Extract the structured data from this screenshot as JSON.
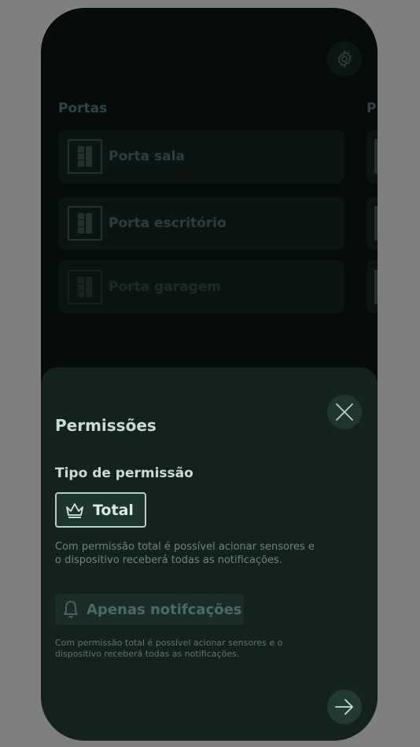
{
  "background": {
    "settings_icon": "gear-icon",
    "sections": [
      {
        "title": "Portas",
        "doors": [
          {
            "label": "Porta sala"
          },
          {
            "label": "Porta escritório"
          },
          {
            "label": "Porta garagem"
          }
        ]
      },
      {
        "title": "P"
      }
    ]
  },
  "sheet": {
    "title": "Permissões",
    "close_icon": "close-icon",
    "subtitle": "Tipo de permissão",
    "options": [
      {
        "label": "Total",
        "icon": "crown-icon",
        "selected": true,
        "description": "Com permissão total é possível acionar sensores e o dispositivo receberá todas as notificações."
      },
      {
        "label": "Apenas notifcações",
        "icon": "bell-icon",
        "selected": false,
        "description": "Com permissão total é possível acionar sensores e o dispositivo receberá todas as notificações."
      }
    ],
    "next_icon": "arrow-right-icon"
  },
  "colors": {
    "overlay": "#7f7f7f",
    "sheet_bg": "#14221f",
    "text_primary": "#c6dcd4",
    "text_muted": "#6e8680",
    "selected_border": "#b4cfc6"
  }
}
